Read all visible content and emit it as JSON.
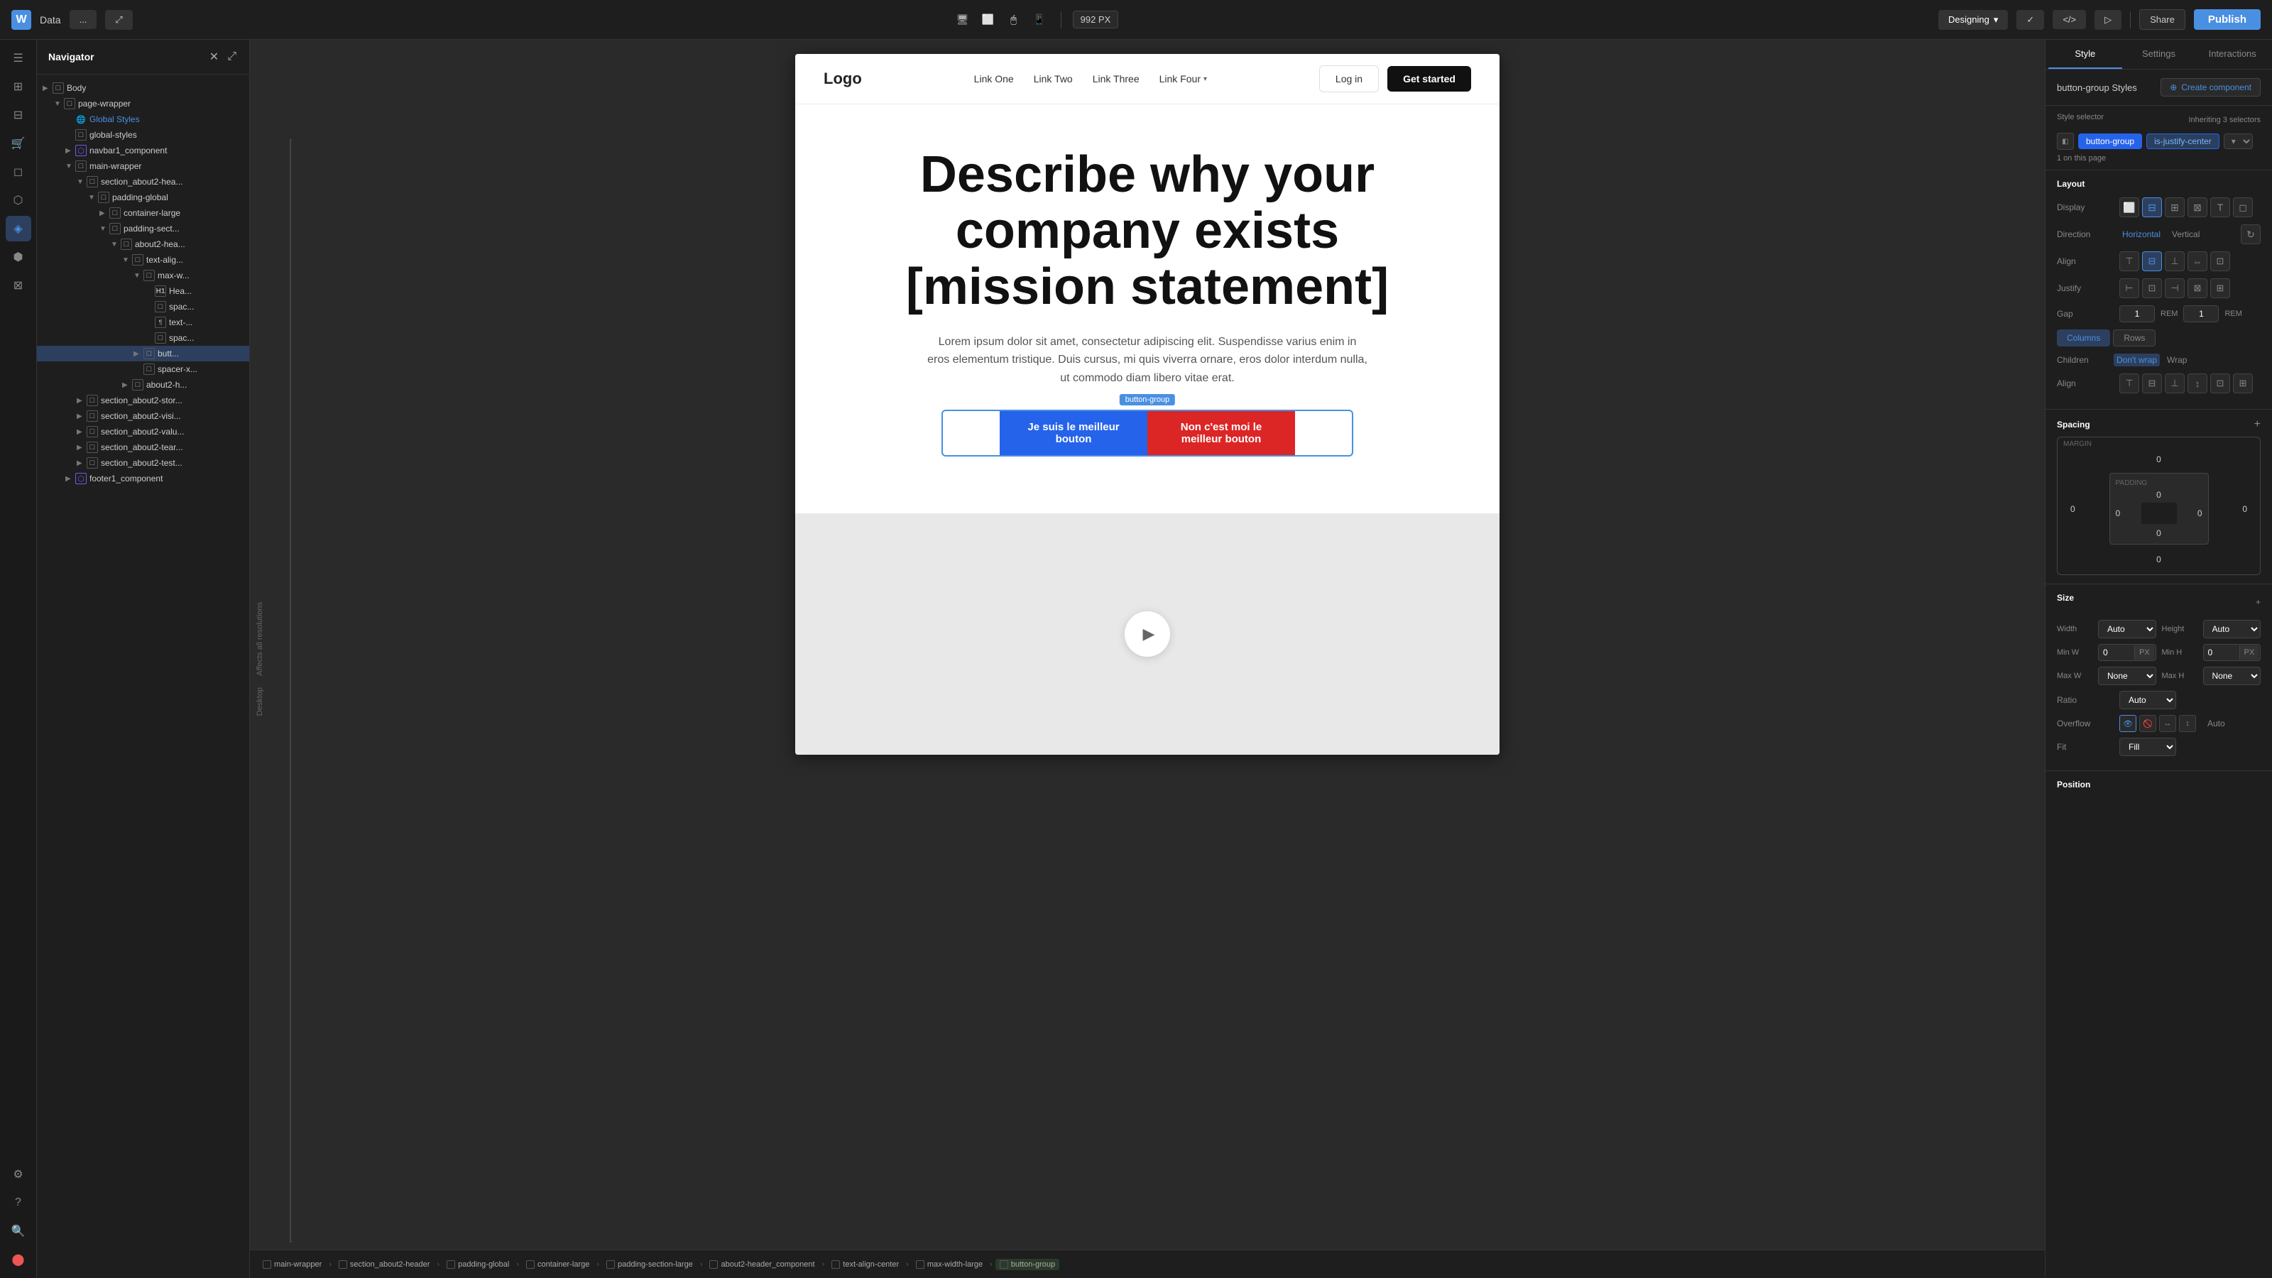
{
  "topbar": {
    "logo": "W",
    "project": "Data",
    "more_label": "...",
    "device_px": "992 PX",
    "designing_label": "Designing",
    "code_label": "</>",
    "share_label": "Share",
    "publish_label": "Publish",
    "devices": [
      "desktop",
      "tablet",
      "monitor",
      "mobile"
    ]
  },
  "navigator": {
    "title": "Navigator",
    "tree": [
      {
        "label": "Body",
        "indent": 0,
        "type": "box",
        "arrow": "▶"
      },
      {
        "label": "page-wrapper",
        "indent": 1,
        "type": "box",
        "arrow": "▼"
      },
      {
        "label": "Global Styles",
        "indent": 2,
        "type": "global",
        "arrow": "",
        "highlighted": true
      },
      {
        "label": "global-styles",
        "indent": 2,
        "type": "box",
        "arrow": ""
      },
      {
        "label": "navbar1_component",
        "indent": 2,
        "type": "component",
        "arrow": "▶"
      },
      {
        "label": "main-wrapper",
        "indent": 2,
        "type": "box",
        "arrow": "▼"
      },
      {
        "label": "section_about2-hea...",
        "indent": 3,
        "type": "box",
        "arrow": "▼"
      },
      {
        "label": "padding-global",
        "indent": 4,
        "type": "box",
        "arrow": "▼"
      },
      {
        "label": "container-large",
        "indent": 5,
        "type": "box",
        "arrow": "▶"
      },
      {
        "label": "padding-sect...",
        "indent": 5,
        "type": "box",
        "arrow": "▼"
      },
      {
        "label": "about2-hea...",
        "indent": 6,
        "type": "box",
        "arrow": "▼"
      },
      {
        "label": "text-alig...",
        "indent": 7,
        "type": "box",
        "arrow": "▼"
      },
      {
        "label": "max-w...",
        "indent": 8,
        "type": "box",
        "arrow": "▼"
      },
      {
        "label": "Hea...",
        "indent": 9,
        "type": "text",
        "arrow": ""
      },
      {
        "label": "spac...",
        "indent": 9,
        "type": "box",
        "arrow": ""
      },
      {
        "label": "text-...",
        "indent": 9,
        "type": "para",
        "arrow": ""
      },
      {
        "label": "spac...",
        "indent": 9,
        "type": "box",
        "arrow": ""
      },
      {
        "label": "butt...",
        "indent": 9,
        "type": "box",
        "arrow": "▶",
        "selected": true
      },
      {
        "label": "spacer-x...",
        "indent": 8,
        "type": "box",
        "arrow": ""
      },
      {
        "label": "about2-h...",
        "indent": 7,
        "type": "box",
        "arrow": "▶"
      },
      {
        "label": "section_about2-stor...",
        "indent": 3,
        "type": "box",
        "arrow": "▶"
      },
      {
        "label": "section_about2-visi...",
        "indent": 3,
        "type": "box",
        "arrow": "▶"
      },
      {
        "label": "section_about2-valu...",
        "indent": 3,
        "type": "box",
        "arrow": "▶"
      },
      {
        "label": "section_about2-tear...",
        "indent": 3,
        "type": "box",
        "arrow": "▶"
      },
      {
        "label": "section_about2-test...",
        "indent": 3,
        "type": "box",
        "arrow": "▶"
      },
      {
        "label": "footer1_component",
        "indent": 2,
        "type": "component",
        "arrow": "▶"
      }
    ]
  },
  "preview": {
    "logo": "Logo",
    "nav_links": [
      "Link One",
      "Link Two",
      "Link Three",
      "Link Four"
    ],
    "nav_has_arrow": [
      false,
      false,
      false,
      true
    ],
    "login_label": "Log in",
    "getstarted_label": "Get started",
    "hero_title": "Describe why your company exists [mission statement]",
    "hero_desc": "Lorem ipsum dolor sit amet, consectetur adipiscing elit. Suspendisse varius enim in eros elementum tristique. Duis cursus, mi quis viverra ornare, eros dolor interdum nulla, ut commodo diam libero vitae erat.",
    "button_group_label": "button-group",
    "btn_primary_label": "Je suis le meilleur bouton",
    "btn_danger_label": "Non c'est moi le meilleur bouton"
  },
  "right_panel": {
    "tabs": [
      "Style",
      "Settings",
      "Interactions"
    ],
    "active_tab": "Style",
    "component_name": "button-group Styles",
    "create_component_label": "Create component",
    "style_selector": {
      "label": "Style selector",
      "inheriting": "Inheriting 3 selectors",
      "badges": [
        "button-group",
        "is-justify-center"
      ],
      "active_badge": "button-group",
      "on_page": "1 on this page"
    },
    "layout": {
      "title": "Layout",
      "display_label": "Display",
      "direction_label": "Direction",
      "direction_options": [
        "Horizontal",
        "Vertical"
      ],
      "active_direction": "Horizontal",
      "align_label": "Align",
      "justify_label": "Justify",
      "gap_label": "Gap",
      "gap_value": "1",
      "gap_unit": "REM",
      "gap_value2": "1",
      "columns_label": "Columns",
      "rows_label": "Rows",
      "children_label": "Children",
      "dont_wrap_label": "Don't wrap",
      "wrap_label": "Wrap",
      "align_label2": "Align"
    },
    "spacing": {
      "title": "Spacing",
      "margin_label": "MARGIN",
      "padding_label": "PADDING",
      "margin_top": "0",
      "margin_right": "0",
      "margin_bottom": "0",
      "margin_left": "0",
      "padding_top": "0",
      "padding_right": "0",
      "padding_bottom": "0",
      "padding_left": "0",
      "center_val": "0"
    },
    "size": {
      "title": "Size",
      "width_label": "Width",
      "height_label": "Height",
      "width_value": "Auto",
      "height_value": "Auto",
      "min_w_label": "Min W",
      "min_h_label": "Min H",
      "min_w_value": "0",
      "min_h_value": "0",
      "min_w_unit": "PX",
      "min_h_unit": "PX",
      "max_w_label": "Max W",
      "max_h_label": "Max H",
      "max_w_value": "None",
      "max_h_value": "None",
      "ratio_label": "Ratio",
      "ratio_value": "Auto",
      "overflow_label": "Overflow",
      "overflow_value": "Auto",
      "fit_label": "Fit",
      "fit_value": "Fill"
    },
    "position": {
      "title": "Position"
    }
  },
  "breadcrumbs": [
    "main-wrapper",
    "section_about2-header",
    "padding-global",
    "container-large",
    "padding-section-large",
    "about2-header_component",
    "text-align-center",
    "max-width-large",
    "button-group"
  ],
  "canvas": {
    "affects_label": "Affects all resolutions",
    "desktop_label": "Desktop"
  }
}
